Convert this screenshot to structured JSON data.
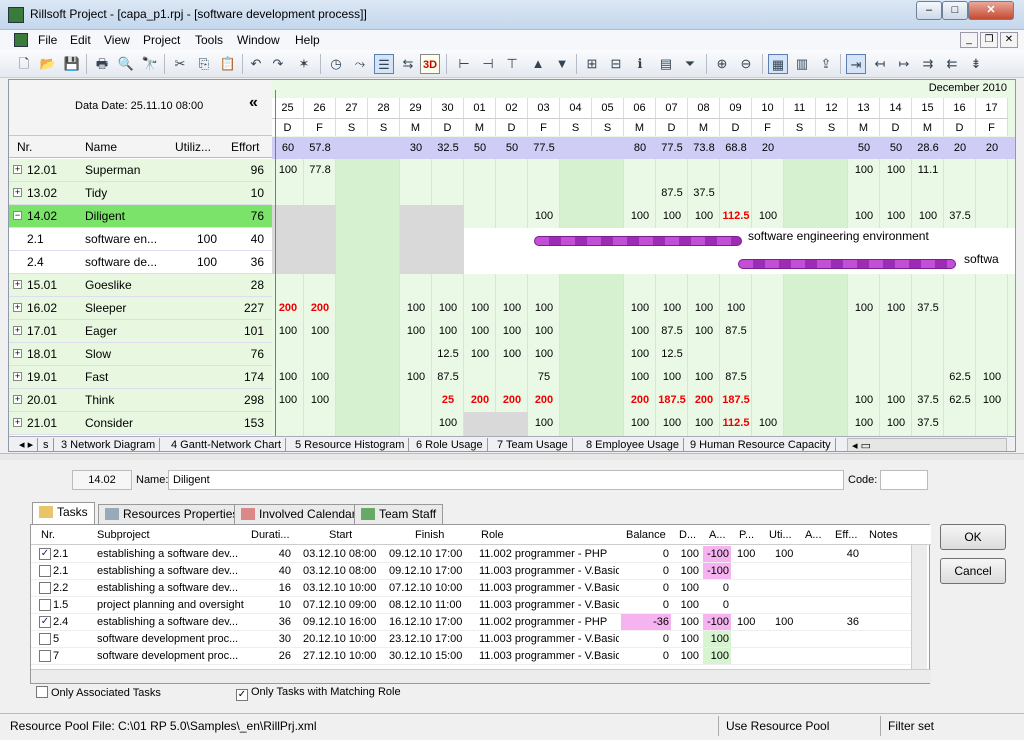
{
  "window": {
    "title": "Rillsoft Project - [capa_p1.rpj - [software development process]]",
    "min": "–",
    "max": "□",
    "close": "✕"
  },
  "menu": [
    "File",
    "Edit",
    "View",
    "Project",
    "Tools",
    "Window",
    "Help"
  ],
  "toolbar_3d": "3D",
  "grid": {
    "data_date": "Data Date: 25.11.10 08:00",
    "collapse_glyph": "«",
    "month_label": "December 2010",
    "columns": {
      "nr": "Nr.",
      "name": "Name",
      "util": "Utiliz...",
      "effort": "Effort"
    },
    "days": [
      "25",
      "26",
      "27",
      "28",
      "29",
      "30",
      "01",
      "02",
      "03",
      "04",
      "05",
      "06",
      "07",
      "08",
      "09",
      "10",
      "11",
      "12",
      "13",
      "14",
      "15",
      "16",
      "17"
    ],
    "dow": [
      "D",
      "F",
      "S",
      "S",
      "M",
      "D",
      "M",
      "D",
      "F",
      "S",
      "S",
      "M",
      "D",
      "M",
      "D",
      "F",
      "S",
      "S",
      "M",
      "D",
      "M",
      "D",
      "F"
    ],
    "totals": [
      "60",
      "57.8",
      "",
      "",
      "30",
      "32.5",
      "50",
      "50",
      "77.5",
      "",
      "",
      "80",
      "77.5",
      "73.8",
      "68.8",
      "20",
      "",
      "",
      "50",
      "50",
      "28.6",
      "20",
      "20"
    ],
    "rows": [
      {
        "toggle": "+",
        "nr": "12.01",
        "name": "Superman",
        "util": "",
        "effort": "96",
        "cells": [
          "100",
          "77.8",
          "",
          "",
          "",
          "",
          "",
          "",
          "",
          "",
          "",
          "",
          "",
          "",
          "",
          "",
          "",
          "",
          "100",
          "100",
          "11.1",
          "",
          ""
        ],
        "red": []
      },
      {
        "toggle": "+",
        "nr": "13.02",
        "name": "Tidy",
        "util": "",
        "effort": "10",
        "cells": [
          "",
          "",
          "",
          "",
          "",
          "",
          "",
          "",
          "",
          "",
          "",
          "",
          "87.5",
          "37.5",
          "",
          "",
          "",
          "",
          "",
          "",
          "",
          "",
          ""
        ],
        "red": []
      },
      {
        "toggle": "−",
        "nr": "14.02",
        "name": "Diligent",
        "util": "",
        "effort": "76",
        "cells": [
          "",
          "",
          "",
          "",
          "",
          "",
          "",
          "",
          "100",
          "",
          "",
          "100",
          "100",
          "100",
          "112.5",
          "100",
          "",
          "",
          "100",
          "100",
          "100",
          "37.5",
          ""
        ],
        "red": [
          14
        ]
      },
      {
        "toggle": "",
        "nr": "2.1",
        "name": "software en...",
        "util": "100",
        "effort": "40",
        "cells": [],
        "red": []
      },
      {
        "toggle": "",
        "nr": "2.4",
        "name": "software de...",
        "util": "100",
        "effort": "36",
        "cells": [],
        "red": []
      },
      {
        "toggle": "+",
        "nr": "15.01",
        "name": "Goeslike",
        "util": "",
        "effort": "28",
        "cells": [],
        "red": []
      },
      {
        "toggle": "+",
        "nr": "16.02",
        "name": "Sleeper",
        "util": "",
        "effort": "227",
        "cells": [
          "200",
          "200",
          "",
          "",
          "100",
          "100",
          "100",
          "100",
          "100",
          "",
          "",
          "100",
          "100",
          "100",
          "100",
          "",
          "",
          "",
          "100",
          "100",
          "37.5",
          "",
          ""
        ],
        "red": [
          0,
          1
        ]
      },
      {
        "toggle": "+",
        "nr": "17.01",
        "name": "Eager",
        "util": "",
        "effort": "101",
        "cells": [
          "100",
          "100",
          "",
          "",
          "100",
          "100",
          "100",
          "100",
          "100",
          "",
          "",
          "100",
          "87.5",
          "100",
          "87.5",
          "",
          "",
          "",
          "",
          "",
          "",
          "",
          ""
        ],
        "red": []
      },
      {
        "toggle": "+",
        "nr": "18.01",
        "name": "Slow",
        "util": "",
        "effort": "76",
        "cells": [
          "",
          "",
          "",
          "",
          "",
          "12.5",
          "100",
          "100",
          "100",
          "",
          "",
          "100",
          "12.5",
          "",
          "",
          "",
          "",
          "",
          "",
          "",
          "",
          "",
          ""
        ],
        "red": []
      },
      {
        "toggle": "+",
        "nr": "19.01",
        "name": "Fast",
        "util": "",
        "effort": "174",
        "cells": [
          "100",
          "100",
          "",
          "",
          "100",
          "87.5",
          "",
          "",
          "75",
          "",
          "",
          "100",
          "100",
          "100",
          "87.5",
          "",
          "",
          "",
          "",
          "",
          "",
          "62.5",
          "100"
        ],
        "red": []
      },
      {
        "toggle": "+",
        "nr": "20.01",
        "name": "Think",
        "util": "",
        "effort": "298",
        "cells": [
          "100",
          "100",
          "",
          "",
          "",
          "25",
          "200",
          "200",
          "200",
          "",
          "",
          "200",
          "187.5",
          "200",
          "187.5",
          "",
          "",
          "",
          "100",
          "100",
          "37.5",
          "62.5",
          "100"
        ],
        "red": [
          5,
          6,
          7,
          8,
          11,
          12,
          13,
          14
        ]
      },
      {
        "toggle": "+",
        "nr": "21.01",
        "name": "Consider",
        "util": "",
        "effort": "153",
        "cells": [
          "",
          "",
          "",
          "",
          "",
          "100",
          "",
          "",
          "100",
          "",
          "",
          "100",
          "100",
          "100",
          "112.5",
          "100",
          "",
          "",
          "100",
          "100",
          "37.5",
          "",
          ""
        ],
        "red": [
          14
        ]
      }
    ],
    "bars": [
      {
        "label": "software engineering environment"
      },
      {
        "label": "softwa"
      }
    ]
  },
  "view_tabs": [
    "s",
    "3 Network Diagram",
    "4 Gantt-Network Chart",
    "5 Resource Histogram",
    "6 Role Usage",
    "7 Team Usage",
    "8 Employee Usage",
    "9 Human Resource Capacity"
  ],
  "detail": {
    "id": "14.02",
    "name_label": "Name:",
    "name_value": "Diligent",
    "code_label": "Code:",
    "tabs": [
      "Tasks",
      "Resources Properties",
      "Involved Calendar",
      "Team Staff"
    ],
    "task_columns": [
      "Nr.",
      "Subproject",
      "Durati...",
      "Start",
      "Finish",
      "Role",
      "Balance",
      "D...",
      "A...",
      "P...",
      "Uti...",
      "A...",
      "Eff...",
      "Notes"
    ],
    "tasks": [
      {
        "checked": true,
        "nr": "2.1",
        "sub": "establishing a software dev...",
        "dur": "40",
        "start": "03.12.10 08:00",
        "finish": "09.12.10 17:00",
        "role": "11.002 programmer - PHP",
        "bal": "0",
        "d": "100",
        "a": "-100",
        "p": "100",
        "uti": "100",
        "a2": "",
        "eff": "40",
        "notes": "",
        "pink_bal": false,
        "a_style": "pink"
      },
      {
        "checked": false,
        "nr": "2.1",
        "sub": "establishing a software dev...",
        "dur": "40",
        "start": "03.12.10 08:00",
        "finish": "09.12.10 17:00",
        "role": "11.003 programmer - V.Basic",
        "bal": "0",
        "d": "100",
        "a": "-100",
        "p": "",
        "uti": "",
        "a2": "",
        "eff": "",
        "notes": "",
        "pink_bal": false,
        "a_style": "pink"
      },
      {
        "checked": false,
        "nr": "2.2",
        "sub": "establishing a software dev...",
        "dur": "16",
        "start": "03.12.10 10:00",
        "finish": "07.12.10 10:00",
        "role": "11.003 programmer - V.Basic",
        "bal": "0",
        "d": "100",
        "a": "0",
        "p": "",
        "uti": "",
        "a2": "",
        "eff": "",
        "notes": "",
        "pink_bal": false,
        "a_style": ""
      },
      {
        "checked": false,
        "nr": "1.5",
        "sub": "project planning and oversight",
        "dur": "10",
        "start": "07.12.10 09:00",
        "finish": "08.12.10 11:00",
        "role": "11.003 programmer - V.Basic",
        "bal": "0",
        "d": "100",
        "a": "0",
        "p": "",
        "uti": "",
        "a2": "",
        "eff": "",
        "notes": "",
        "pink_bal": false,
        "a_style": ""
      },
      {
        "checked": true,
        "nr": "2.4",
        "sub": "establishing a software dev...",
        "dur": "36",
        "start": "09.12.10 16:00",
        "finish": "16.12.10 17:00",
        "role": "11.002 programmer - PHP",
        "bal": "-36",
        "d": "100",
        "a": "-100",
        "p": "100",
        "uti": "100",
        "a2": "",
        "eff": "36",
        "notes": "",
        "pink_bal": true,
        "a_style": "pink"
      },
      {
        "checked": false,
        "nr": "5",
        "sub": "software development proc...",
        "dur": "30",
        "start": "20.12.10 10:00",
        "finish": "23.12.10 17:00",
        "role": "11.003 programmer - V.Basic",
        "bal": "0",
        "d": "100",
        "a": "100",
        "p": "",
        "uti": "",
        "a2": "",
        "eff": "",
        "notes": "",
        "pink_bal": false,
        "a_style": "green"
      },
      {
        "checked": false,
        "nr": "7",
        "sub": "software development proc...",
        "dur": "26",
        "start": "27.12.10 10:00",
        "finish": "30.12.10 15:00",
        "role": "11.003 programmer - V.Basic",
        "bal": "0",
        "d": "100",
        "a": "100",
        "p": "",
        "uti": "",
        "a2": "",
        "eff": "",
        "notes": "",
        "pink_bal": false,
        "a_style": "green"
      }
    ],
    "only_associated": "Only Associated Tasks",
    "only_matching": "Only Tasks with Matching Role",
    "ok": "OK",
    "cancel": "Cancel"
  },
  "status": {
    "pool_file": "Resource Pool File: C:\\01 RP 5.0\\Samples\\_en\\RillPrj.xml",
    "use_pool": "Use Resource Pool",
    "filter": "Filter set"
  }
}
